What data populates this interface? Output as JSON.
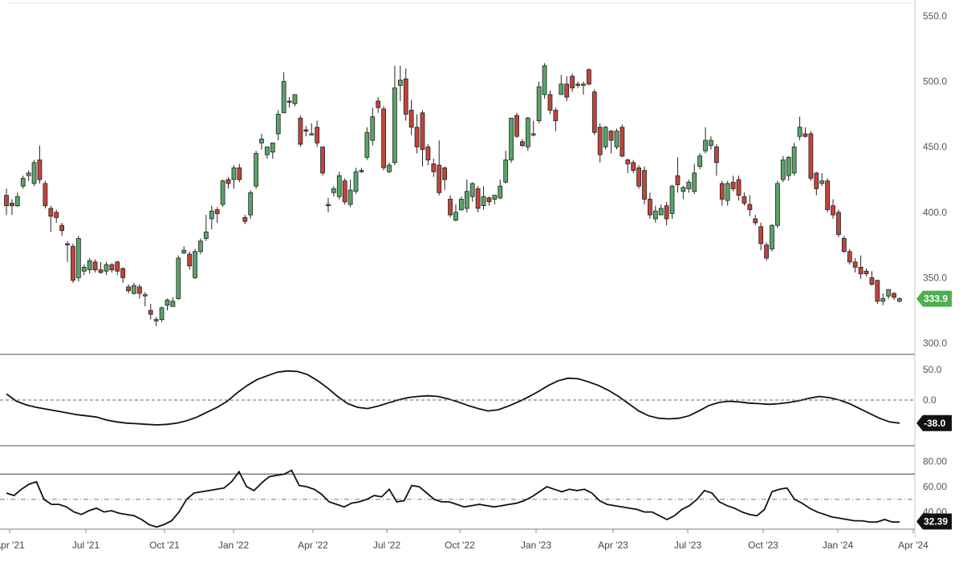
{
  "chart_data": [
    {
      "type": "candlestick",
      "x_axis": {
        "ticks": [
          "Apr '21",
          "Jul '21",
          "Oct '21",
          "Jan '22",
          "Apr '22",
          "Jul '22",
          "Oct '22",
          "Jan '23",
          "Apr '23",
          "Jul '23",
          "Oct '23",
          "Jan '24",
          "Apr '24"
        ]
      },
      "y_axis": {
        "range": [
          300,
          550
        ],
        "ticks": [
          "300.0",
          "350.0",
          "400.0",
          "450.0",
          "500.0",
          "550.0"
        ]
      },
      "grid": false,
      "last_price": {
        "value": 333.9,
        "label": "333.9",
        "color": "#4caf50"
      },
      "colors": {
        "up": "#5aa468",
        "down": "#c0453a"
      },
      "candles": [
        [
          413,
          405,
          398,
          418
        ],
        [
          407,
          405,
          398,
          410
        ],
        [
          405,
          412,
          404,
          415
        ],
        [
          420,
          426,
          418,
          428
        ],
        [
          428,
          430,
          424,
          432
        ],
        [
          422,
          438,
          420,
          440
        ],
        [
          440,
          425,
          422,
          451
        ],
        [
          422,
          405,
          403,
          424
        ],
        [
          403,
          397,
          385,
          405
        ],
        [
          400,
          396,
          392,
          402
        ],
        [
          390,
          386,
          382,
          392
        ],
        [
          376,
          375,
          362,
          378
        ],
        [
          374,
          348,
          346,
          376
        ],
        [
          350,
          380,
          347,
          382
        ],
        [
          355,
          358,
          352,
          360
        ],
        [
          356,
          363,
          353,
          365
        ],
        [
          362,
          356,
          354,
          364
        ],
        [
          356,
          354,
          353,
          362
        ],
        [
          355,
          360,
          352,
          362
        ],
        [
          360,
          356,
          354,
          361
        ],
        [
          362,
          355,
          352,
          363
        ],
        [
          357,
          350,
          346,
          358
        ],
        [
          343,
          340,
          338,
          345
        ],
        [
          338,
          344,
          337,
          346
        ],
        [
          343,
          338,
          334,
          345
        ],
        [
          337,
          337,
          328,
          339
        ],
        [
          325,
          322,
          318,
          330
        ],
        [
          318,
          317,
          313,
          320
        ],
        [
          318,
          327,
          316,
          328
        ],
        [
          329,
          333,
          325,
          334
        ],
        [
          328,
          332,
          328,
          335
        ],
        [
          334,
          365,
          333,
          367
        ],
        [
          369,
          371,
          368,
          374
        ],
        [
          368,
          359,
          356,
          370
        ],
        [
          350,
          370,
          349,
          372
        ],
        [
          370,
          378,
          368,
          380
        ],
        [
          380,
          385,
          378,
          398
        ],
        [
          395,
          401,
          387,
          405
        ],
        [
          402,
          399,
          392,
          404
        ],
        [
          406,
          424,
          404,
          425
        ],
        [
          425,
          422,
          418,
          427
        ],
        [
          425,
          434,
          418,
          436
        ],
        [
          434,
          425,
          423,
          437
        ],
        [
          396,
          393,
          391,
          398
        ],
        [
          398,
          415,
          395,
          417
        ],
        [
          420,
          445,
          418,
          447
        ],
        [
          453,
          456,
          448,
          460
        ],
        [
          444,
          450,
          441,
          450
        ],
        [
          446,
          453,
          441,
          453
        ],
        [
          460,
          475,
          455,
          478
        ],
        [
          476,
          500,
          476,
          507
        ],
        [
          485,
          484,
          480,
          488
        ],
        [
          483,
          490,
          481,
          490
        ],
        [
          472,
          452,
          450,
          474
        ],
        [
          463,
          462,
          458,
          466
        ],
        [
          460,
          460,
          459,
          468
        ],
        [
          465,
          453,
          450,
          470
        ],
        [
          450,
          430,
          428,
          450
        ],
        [
          406,
          405,
          400,
          411
        ],
        [
          415,
          418,
          412,
          420
        ],
        [
          412,
          428,
          410,
          431
        ],
        [
          424,
          408,
          406,
          426
        ],
        [
          406,
          417,
          404,
          425
        ],
        [
          416,
          431,
          414,
          434
        ],
        [
          432,
          431,
          430,
          434
        ],
        [
          442,
          461,
          440,
          465
        ],
        [
          455,
          473,
          451,
          480
        ],
        [
          485,
          480,
          476,
          488
        ],
        [
          479,
          434,
          432,
          481
        ],
        [
          431,
          436,
          430,
          438
        ],
        [
          438,
          495,
          436,
          512
        ],
        [
          497,
          501,
          485,
          512
        ],
        [
          502,
          475,
          470,
          510
        ],
        [
          478,
          465,
          459,
          486
        ],
        [
          465,
          450,
          445,
          475
        ],
        [
          476,
          448,
          435,
          478
        ],
        [
          450,
          440,
          436,
          452
        ],
        [
          437,
          431,
          427,
          441
        ],
        [
          436,
          415,
          413,
          455
        ],
        [
          434,
          425,
          417,
          435
        ],
        [
          410,
          398,
          396,
          413
        ],
        [
          394,
          400,
          393,
          406
        ],
        [
          402,
          410,
          401,
          412
        ],
        [
          403,
          416,
          400,
          425
        ],
        [
          412,
          422,
          408,
          423
        ],
        [
          418,
          403,
          400,
          420
        ],
        [
          405,
          412,
          402,
          420
        ],
        [
          411,
          408,
          405,
          412
        ],
        [
          410,
          413,
          406,
          413
        ],
        [
          411,
          420,
          410,
          425
        ],
        [
          423,
          440,
          422,
          447
        ],
        [
          440,
          472,
          438,
          472
        ],
        [
          474,
          458,
          457,
          476
        ],
        [
          454,
          451,
          450,
          456
        ],
        [
          450,
          472,
          447,
          473
        ],
        [
          460,
          460,
          458,
          470
        ],
        [
          470,
          496,
          468,
          500
        ],
        [
          490,
          512,
          487,
          514
        ],
        [
          490,
          478,
          475,
          493
        ],
        [
          478,
          470,
          462,
          480
        ],
        [
          490,
          498,
          490,
          505
        ],
        [
          498,
          488,
          485,
          504
        ],
        [
          504,
          495,
          492,
          506
        ],
        [
          498,
          497,
          495,
          500
        ],
        [
          498,
          498,
          490,
          500
        ],
        [
          509,
          498,
          497,
          510
        ],
        [
          492,
          461,
          459,
          494
        ],
        [
          465,
          444,
          438,
          468
        ],
        [
          450,
          465,
          448,
          466
        ],
        [
          462,
          455,
          445,
          463
        ],
        [
          450,
          462,
          448,
          464
        ],
        [
          465,
          443,
          442,
          467
        ],
        [
          440,
          437,
          430,
          441
        ],
        [
          438,
          432,
          430,
          440
        ],
        [
          434,
          420,
          418,
          436
        ],
        [
          432,
          410,
          406,
          435
        ],
        [
          410,
          398,
          395,
          415
        ],
        [
          395,
          401,
          392,
          405
        ],
        [
          398,
          403,
          398,
          406
        ],
        [
          405,
          395,
          390,
          408
        ],
        [
          399,
          420,
          395,
          421
        ],
        [
          428,
          421,
          415,
          442
        ],
        [
          416,
          419,
          410,
          420
        ],
        [
          418,
          423,
          415,
          425
        ],
        [
          416,
          430,
          414,
          437
        ],
        [
          435,
          443,
          433,
          445
        ],
        [
          447,
          455,
          445,
          465
        ],
        [
          451,
          455,
          448,
          458
        ],
        [
          450,
          438,
          428,
          452
        ],
        [
          422,
          410,
          405,
          424
        ],
        [
          409,
          422,
          405,
          424
        ],
        [
          423,
          418,
          416,
          428
        ],
        [
          425,
          413,
          409,
          428
        ],
        [
          412,
          407,
          405,
          415
        ],
        [
          406,
          402,
          397,
          413
        ],
        [
          395,
          392,
          390,
          398
        ],
        [
          389,
          376,
          371,
          392
        ],
        [
          375,
          365,
          363,
          377
        ],
        [
          372,
          390,
          370,
          391
        ],
        [
          390,
          422,
          388,
          424
        ],
        [
          425,
          440,
          423,
          443
        ],
        [
          428,
          442,
          424,
          443
        ],
        [
          430,
          450,
          428,
          453
        ],
        [
          458,
          465,
          455,
          473
        ],
        [
          460,
          458,
          457,
          465
        ],
        [
          460,
          426,
          424,
          462
        ],
        [
          430,
          418,
          413,
          431
        ],
        [
          422,
          424,
          420,
          430
        ],
        [
          424,
          402,
          400,
          426
        ],
        [
          405,
          398,
          395,
          410
        ],
        [
          400,
          383,
          381,
          402
        ],
        [
          380,
          370,
          369,
          382
        ],
        [
          370,
          362,
          360,
          372
        ],
        [
          362,
          358,
          354,
          365
        ],
        [
          358,
          353,
          349,
          367
        ],
        [
          355,
          353,
          351,
          357
        ],
        [
          350,
          345,
          344,
          355
        ],
        [
          348,
          332,
          330,
          348
        ],
        [
          332,
          334,
          329,
          338
        ],
        [
          336,
          341,
          334,
          341
        ],
        [
          338,
          335,
          333,
          339
        ],
        [
          332,
          334,
          331,
          335
        ]
      ]
    },
    {
      "type": "line",
      "name_shown": false,
      "y_axis": {
        "range": [
          -70,
          70
        ],
        "ticks": [
          "50.0",
          "0.0"
        ],
        "reference_line": 0
      },
      "last_value": {
        "value": -38.0,
        "label": "-38.0"
      },
      "series": [
        {
          "values": [
            10,
            -2,
            -8,
            -12,
            -15,
            -18,
            -21,
            -24,
            -26,
            -28,
            -33,
            -36,
            -38,
            -39,
            -40,
            -41,
            -40,
            -38,
            -34,
            -28,
            -20,
            -12,
            -2,
            12,
            24,
            34,
            40,
            46,
            48,
            47,
            42,
            32,
            20,
            6,
            -6,
            -12,
            -14,
            -10,
            -5,
            0,
            4,
            6,
            7,
            6,
            2,
            -3,
            -9,
            -14,
            -18,
            -16,
            -10,
            -3,
            5,
            14,
            24,
            32,
            36,
            35,
            30,
            24,
            16,
            6,
            -6,
            -18,
            -26,
            -30,
            -31,
            -30,
            -26,
            -18,
            -9,
            -4,
            -2,
            -3,
            -5,
            -6,
            -7,
            -6,
            -4,
            -1,
            3,
            6,
            4,
            0,
            -6,
            -14,
            -22,
            -30,
            -36,
            -38
          ]
        }
      ]
    },
    {
      "type": "line",
      "y_axis": {
        "range": [
          20,
          90
        ],
        "ticks": [
          "80.00",
          "60.00",
          "40.00"
        ],
        "reference_lines": [
          70,
          50,
          30
        ]
      },
      "last_value": {
        "value": 32.39,
        "label": "32.39"
      },
      "series": [
        {
          "values": [
            55,
            53,
            58,
            62,
            64,
            50,
            46,
            46,
            44,
            40,
            38,
            41,
            43,
            40,
            41,
            39,
            38,
            37,
            34,
            30,
            28,
            30,
            33,
            40,
            50,
            55,
            56,
            57,
            58,
            59,
            64,
            72,
            60,
            57,
            63,
            68,
            69,
            70,
            73,
            61,
            60,
            58,
            54,
            48,
            46,
            44,
            47,
            48,
            50,
            53,
            52,
            58,
            48,
            49,
            61,
            60,
            55,
            50,
            48,
            48,
            46,
            44,
            45,
            46,
            45,
            44,
            45,
            46,
            47,
            49,
            52,
            56,
            60,
            58,
            56,
            58,
            57,
            58,
            55,
            49,
            46,
            45,
            44,
            43,
            42,
            40,
            40,
            37,
            34,
            37,
            42,
            45,
            50,
            57,
            55,
            48,
            45,
            43,
            40,
            38,
            37,
            42,
            56,
            58,
            59,
            50,
            47,
            43,
            40,
            38,
            36,
            35,
            34,
            33,
            33,
            32,
            32,
            34,
            32,
            32
          ]
        }
      ]
    }
  ]
}
